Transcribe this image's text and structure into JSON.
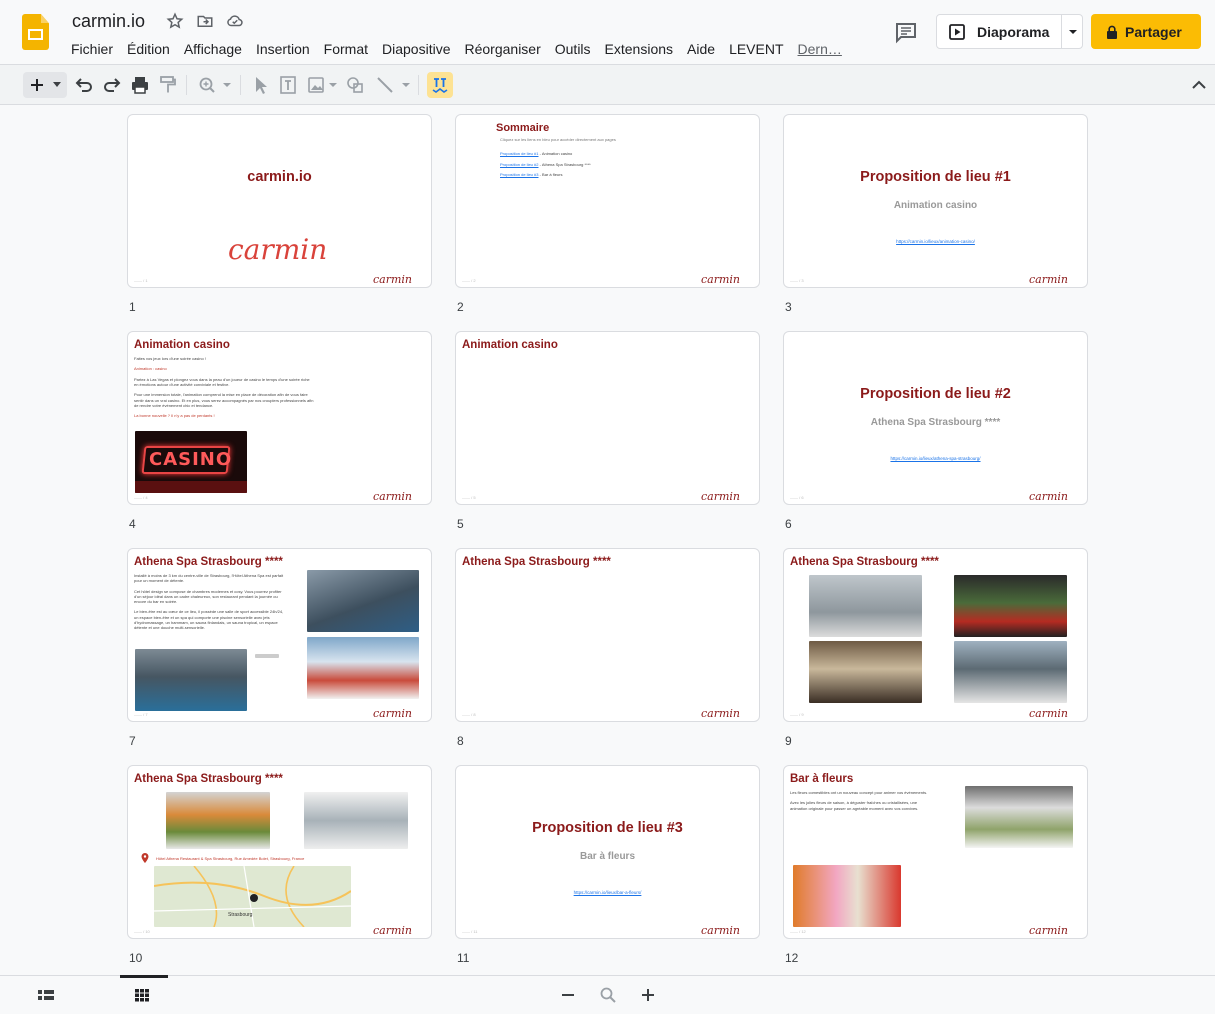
{
  "app": {
    "doc_title": "carmin.io"
  },
  "menu": [
    "Fichier",
    "Édition",
    "Affichage",
    "Insertion",
    "Format",
    "Diapositive",
    "Réorganiser",
    "Outils",
    "Extensions",
    "Aide",
    "LEVENT",
    "Dern…"
  ],
  "header": {
    "slideshow_label": "Diaporama",
    "share_label": "Partager"
  },
  "colors": {
    "accent_yellow": "#fbbc04",
    "slide_red": "#8b1a1a",
    "link_blue": "#1a73e8",
    "active_tool": "#fde293"
  },
  "toolbar_icons": [
    "add-icon",
    "dropdown-icon",
    "undo-icon",
    "redo-icon",
    "print-icon",
    "paint-format-icon",
    "zoom-icon",
    "select-icon",
    "text-box-icon",
    "image-icon",
    "shape-icon",
    "line-icon",
    "spelling-icon",
    "collapse-icon"
  ],
  "slides": [
    {
      "number": "1",
      "title": "carmin.io",
      "logo": "carmin"
    },
    {
      "number": "2",
      "title": "Sommaire",
      "subtitle": "Cliquez sur les liens en bleu pour accéder directement aux pages",
      "links": [
        {
          "link": "Proposition de lieu #1",
          "rest": " - Animation casino"
        },
        {
          "link": "Proposition de lieu #2",
          "rest": " - Athena Spa Strasbourg ****"
        },
        {
          "link": "Proposition de lieu #3",
          "rest": " - Bar à fleurs"
        }
      ]
    },
    {
      "number": "3",
      "title": "Proposition de lieu #1",
      "subtitle": "Animation casino",
      "url": "https://carmin.io/lieux/animation-casino/"
    },
    {
      "number": "4",
      "title": "Animation casino",
      "lines": [
        "Faites vos jeux lors d'une soirée casino !",
        "Animation : casino",
        "Partez à Las Vegas et plongez vous dans la peau d'un joueur de casino le temps d'une soirée riche en émotions autour d'une activité conviviale et festive.",
        "Pour une immersion totale, l'animation comprend la mise en place de décoration afin de vous faire sentir dans un vrai casino. Et en plus, vous serez accompagnés par nos croupiers professionnels afin de rendre votre événement chic et tendance.",
        "La bonne nouvelle ? Il n'y a pas de perdants !"
      ],
      "photo_label": "CASINO"
    },
    {
      "number": "5",
      "title": "Animation casino"
    },
    {
      "number": "6",
      "title": "Proposition de lieu #2",
      "subtitle": "Athena Spa Strasbourg ****",
      "url": "https://carmin.io/lieux/athena-spa-strasbourg/"
    },
    {
      "number": "7",
      "title": "Athena Spa Strasbourg ****",
      "lines": [
        "Installé à moins de 3 km du centre-ville de Strasbourg, l'Hôtel Athena Spa est parfait pour un moment de détente.",
        "Cet hôtel design se compose de chambres modernes et cosy. Vous pourrez profiter d'un séjour idéal dans un cadre chaleureux, son restaurant pendant la journée ou encore du bar en soirée.",
        "Le bien-être est au cœur de ce lieu, il possède une salle de sport accessible 24h/24, un espace bien-être et un spa qui comporte une piscine sensorielle avec jets d'hydromassage, un hammam, un sauna finlandais, un sauna tropical, un espace détente et une douche multi-sensorielle."
      ]
    },
    {
      "number": "8",
      "title": "Athena Spa Strasbourg ****"
    },
    {
      "number": "9",
      "title": "Athena Spa Strasbourg ****"
    },
    {
      "number": "10",
      "title": "Athena Spa Strasbourg ****",
      "address": "Hôtel Athena Restaurant & Spa Strasbourg, Rue Amedée Bolet, Strasbourg, France",
      "map_label": "Strasbourg"
    },
    {
      "number": "11",
      "title": "Proposition de lieu #3",
      "subtitle": "Bar à fleurs",
      "url": "https://carmin.io/lieux/bar-a-fleurs/"
    },
    {
      "number": "12",
      "title": "Bar à fleurs",
      "lines": [
        "Les fleurs comestibles ont un nouveau concept pour animer vos événements.",
        "Avec les jolies fleurs de saison, à déguster fraîches ou cristallisées, une animation originale pour passer un agréable moment avec vos convives."
      ]
    }
  ]
}
